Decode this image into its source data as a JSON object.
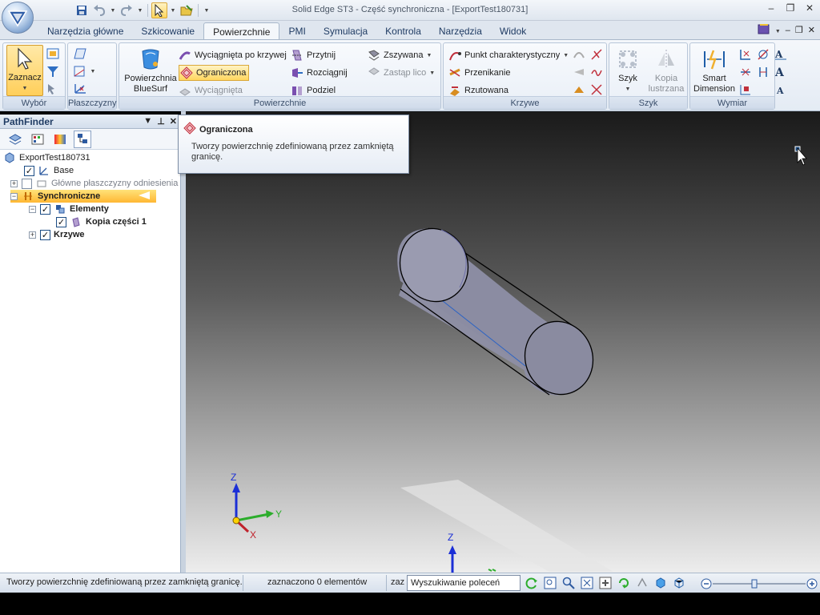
{
  "window": {
    "title": "Solid Edge ST3 - Część synchroniczna - [ExportTest180731]"
  },
  "tabs": [
    {
      "label": "Narzędzia główne"
    },
    {
      "label": "Szkicowanie"
    },
    {
      "label": "Powierzchnie",
      "active": true
    },
    {
      "label": "PMI"
    },
    {
      "label": "Symulacja"
    },
    {
      "label": "Kontrola"
    },
    {
      "label": "Narzędzia"
    },
    {
      "label": "Widok"
    }
  ],
  "ribbon": {
    "wybor": {
      "label": "Wybór",
      "select_label": "Zaznacz"
    },
    "plaszczyzny": {
      "label": "Płaszczyzny"
    },
    "powierzchnie": {
      "label": "Powierzchnie",
      "bluesurf_line1": "Powierzchnia",
      "bluesurf_line2": "BlueSurf",
      "wyciagnieta_po_krzywej": "Wyciągnięta po krzywej",
      "ograniczona": "Ograniczona",
      "wyciagnieta": "Wyciągnięta",
      "przytnij": "Przytnij",
      "rozciagnij": "Rozciągnij",
      "podziel": "Podziel",
      "zszywana": "Zszywana",
      "zastap_lico": "Zastąp lico"
    },
    "krzywe": {
      "label": "Krzywe",
      "punkt": "Punkt charakterystyczny",
      "przenikanie": "Przenikanie",
      "rzutowana": "Rzutowana"
    },
    "szyk": {
      "label": "Szyk",
      "szyk_btn": "Szyk",
      "kopia_line1": "Kopia",
      "kopia_line2": "lustrzana"
    },
    "wymiar": {
      "label": "Wymiar",
      "smart_line1": "Smart",
      "smart_line2": "Dimension"
    }
  },
  "pathfinder": {
    "title": "PathFinder",
    "tree": [
      {
        "label": "ExportTest180731"
      },
      {
        "label": "Base"
      },
      {
        "label": "Główne płaszczyzny odniesienia"
      },
      {
        "label": "Synchroniczne"
      },
      {
        "label": "Elementy"
      },
      {
        "label": "Kopia części 1"
      },
      {
        "label": "Krzywe"
      }
    ]
  },
  "tooltip": {
    "title": "Ograniczona",
    "description": "Tworzy powierzchnię zdefiniowaną przez zamkniętą granicę."
  },
  "viewport": {
    "axis_z": "Z",
    "axis_y": "Y",
    "axis_x": "X",
    "axis_z2": "Z"
  },
  "statusbar": {
    "prompt": "Tworzy powierzchnię zdefiniowaną przez zamkniętą granicę.",
    "selection": "zaznaczono 0 elementów",
    "truncated": "zaz",
    "search_value": "Wyszukiwanie poleceń"
  },
  "colors": {
    "accent_orange": "#ffcf5a",
    "ribbon_blue": "#dfe6ef",
    "cylinder": "#8d8ea3"
  }
}
